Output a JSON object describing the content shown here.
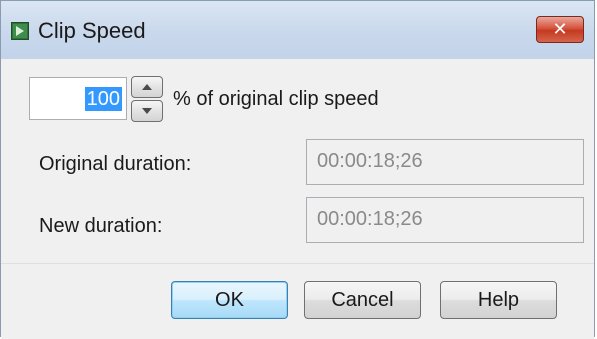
{
  "window": {
    "title": "Clip Speed",
    "close_glyph": "✕",
    "icon": "app-icon"
  },
  "speed": {
    "value": "100",
    "label": "% of original clip speed"
  },
  "original_duration": {
    "label": "Original duration:",
    "value": "00:00:18;26"
  },
  "new_duration": {
    "label": "New duration:",
    "value": "00:00:18;26"
  },
  "buttons": {
    "ok": "OK",
    "cancel": "Cancel",
    "help": "Help"
  },
  "colors": {
    "close_button": "#c43a20",
    "selection": "#3399ff",
    "default_button_border": "#3c7fb1"
  }
}
